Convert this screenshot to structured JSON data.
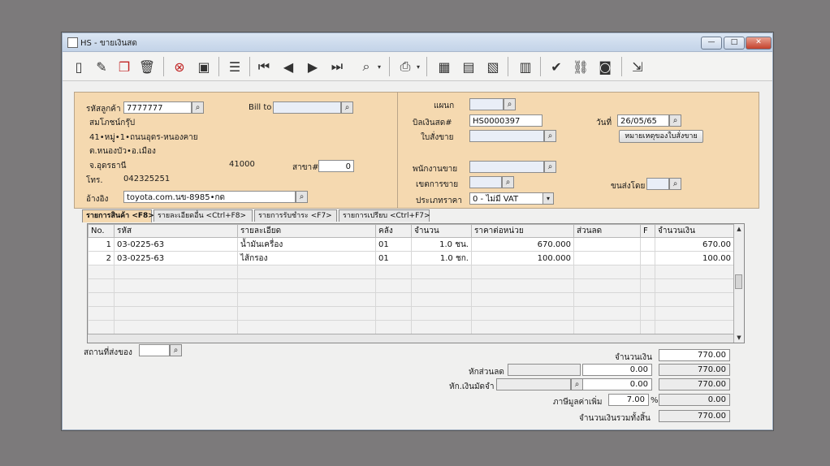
{
  "window": {
    "title": "HS - ขายเงินสด",
    "min": "—",
    "max": "□",
    "close": "✕"
  },
  "toolbar": {
    "icons": [
      "new-icon",
      "edit-icon",
      "copy-icon",
      "delete-icon",
      "cancel-icon",
      "save-icon",
      "print-preview-icon",
      "first-icon",
      "prev-icon",
      "next-icon",
      "last-icon",
      "find-icon",
      "printer-icon",
      "calc-icon",
      "report-icon",
      "export-icon",
      "attach-icon",
      "approve-icon",
      "link-icon",
      "ok-icon",
      "exit-icon"
    ]
  },
  "customer": {
    "code_label": "รหัสลูกค้า",
    "code": "7777777",
    "name": "สมโภชน์กรุ๊ป",
    "addr1": "41•หมู่•1•ถนนอุดร-หนองคาย",
    "addr2": "ต.หนองบัว•อ.เมือง",
    "addr3": "จ.อุดรธานี",
    "zip": "41000",
    "branch_label": "สาขา#",
    "branch": "0",
    "phone_label": "โทร.",
    "phone": "042325251",
    "billto_label": "Bill to",
    "billto": "",
    "ref_label": "อ้างอิง",
    "ref": "toyota.com.นข-8985•กด"
  },
  "doc": {
    "dept_label": "แผนก",
    "dept": "",
    "bill_label": "บิลเงินสด#",
    "bill": "HS0000397",
    "order_label": "ใบสั่งขาย",
    "order": "",
    "date_label": "วันที่",
    "date": "26/05/65",
    "note_button": "หมายเหตุของใบสั่งขาย",
    "seller_label": "พนักงานขาย",
    "seller": "",
    "area_label": "เขตการขาย",
    "area": "",
    "ship_label": "ขนส่งโดย",
    "ship": "",
    "vattype_label": "ประเภทราคา",
    "vattype": "0 - ไม่มี VAT"
  },
  "tabs": [
    "รายการสินค้า <F8>",
    "รายละเอียดอื่น <Ctrl+F8>",
    "รายการรับชำระ <F7>",
    "รายการเปรียบ <Ctrl+F7>"
  ],
  "grid": {
    "headers": [
      "No.",
      "รหัส",
      "รายละเอียด",
      "คลัง",
      "จำนวน",
      "ราคาต่อหน่วย",
      "ส่วนลด",
      "F",
      "จำนวนเงิน"
    ],
    "rows": [
      {
        "no": "1",
        "code": "03-0225-63",
        "desc": "น้ำมันเครื่อง",
        "wh": "01",
        "qty": "1.0",
        "unit": "ชน.",
        "price": "670.000",
        "disc": "",
        "f": "",
        "amount": "670.00"
      },
      {
        "no": "2",
        "code": "03-0225-63",
        "desc": "ไส้กรอง",
        "wh": "01",
        "qty": "1.0",
        "unit": "ชก.",
        "price": "100.000",
        "disc": "",
        "f": "",
        "amount": "100.00"
      }
    ]
  },
  "footer": {
    "place_label": "สถานที่ส่งของ",
    "place": "",
    "total_label": "จำนวนเงิน",
    "total": "770.00",
    "discount_label": "หักส่วนลด",
    "discount_rate": "",
    "discount": "0.00",
    "after_discount": "770.00",
    "deposit_label": "หัก.เงินมัดจำ",
    "deposit_ref": "",
    "deposit": "0.00",
    "after_deposit": "770.00",
    "vat_label": "ภาษีมูลค่าเพิ่ม",
    "vat_rate": "7.00",
    "vat_pct": "%",
    "vat": "0.00",
    "grand_label": "จำนวนเงินรวมทั้งสิ้น",
    "grand": "770.00"
  }
}
